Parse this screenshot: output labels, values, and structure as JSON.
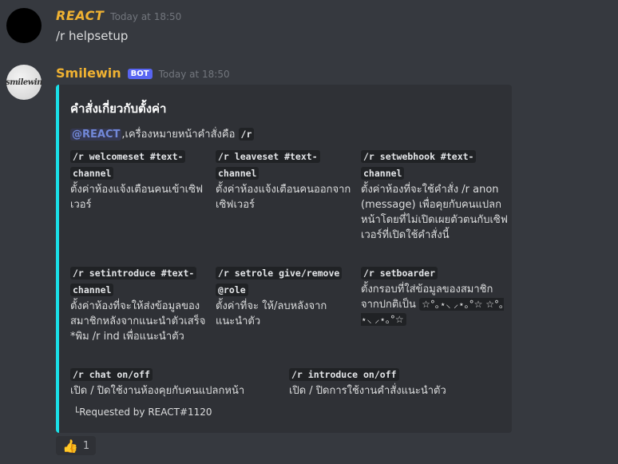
{
  "message1": {
    "username": "REACT",
    "timestamp": "Today at 18:50",
    "content": "/r helpsetup"
  },
  "message2": {
    "username": "Smilewin",
    "badge": "BOT",
    "timestamp": "Today at 18:50",
    "avatar_text": "smilewin",
    "embed": {
      "accent_color": "#1adfe7",
      "title": "คำสั่งเกี่ยวกับตั้งค่า",
      "mention": "@REACT",
      "description_text": ",เครื่องหมายหน้าคำสั่งคือ",
      "prefix": "/r",
      "fields": [
        {
          "name": "/r welcomeset #text-channel",
          "value": "ตั้งค่าห้องแจ้งเตือนคนเข้าเซิฟเวอร์"
        },
        {
          "name": "/r leaveset #text-channel",
          "value": "ตั้งค่าห้องแจ้งเตือนคนออกจากเซิฟเวอร์"
        },
        {
          "name": "/r setwebhook #text-channel",
          "value": "ตั้งค่าห้องที่จะใช้คำสั่ง /r anon (message) เพื่อคุยกับคนแปลกหน้าโดยที่ไม่เปิดเผยตัวตนกับเซิฟเวอร์ที่เปิดใช้คำสั่งนี้"
        },
        {
          "name": "/r setintroduce #text-channel",
          "value": "ตั้งค่าห้องที่จะให้ส่งข้อมูลของสมาชิกหลังจากแนะนำตัวเสร็จ *พิม /r ind เพื่อแนะนำตัว"
        },
        {
          "name": "/r setrole give/remove @role",
          "value": "ตั้งค่าที่จะ ให้/ลบหลังจากแนะนำตัว"
        },
        {
          "name": "/r setboarder",
          "value": "ตั้งกรอบที่ใส่ข้อมูลของสมาชิกจากปกติเป็น",
          "value_extra": "☆°｡⋆⸜ ⸝⋆｡°☆ ☆°｡⋆⸜ ⸝⋆｡°☆"
        },
        {
          "name": "/r chat on/off",
          "value": "เปิด / ปิดใช้งานห้องคุยกับคนแปลกหน้า"
        },
        {
          "name": "/r introduce on/off",
          "value": "เปิด / ปิดการใช้งานคำสั่งแนะนำตัว"
        }
      ],
      "footer": "└Requested by REACT#1120"
    }
  },
  "reaction": {
    "emoji": "👍",
    "count": "1"
  }
}
